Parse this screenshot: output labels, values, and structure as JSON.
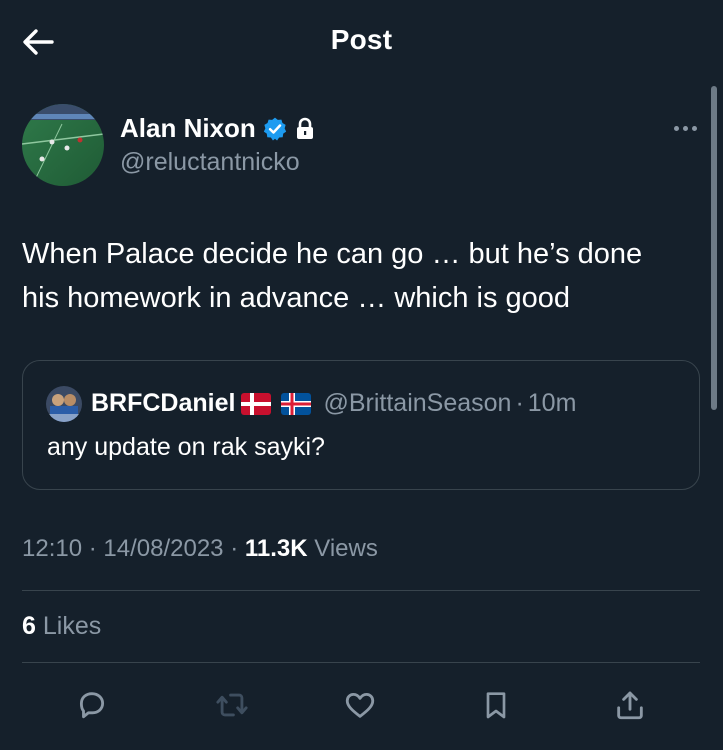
{
  "header": {
    "title": "Post"
  },
  "author": {
    "name": "Alan Nixon",
    "handle": "@reluctantnicko"
  },
  "tweet": {
    "text_line1": "When Palace decide he can go … but he’s done",
    "text_line2": "his homework in advance … which is good"
  },
  "quote": {
    "name": "BRFCDaniel",
    "handle": "@BrittainSeason",
    "separator": "·",
    "time": "10m",
    "text": "any update on rak sayki?"
  },
  "meta": {
    "time": "12:10",
    "sep1": "·",
    "date": "14/08/2023",
    "sep2": "·",
    "views_count": "11.3K",
    "views_label": "Views"
  },
  "likes": {
    "count": "6",
    "label": "Likes"
  },
  "colors": {
    "background": "#15202b",
    "secondary_text": "#8b98a5",
    "verified": "#1d9bf0",
    "divider": "#38444d"
  },
  "icons": [
    "back-arrow-icon",
    "verified-badge-icon",
    "lock-icon",
    "more-icon",
    "reply-icon",
    "retweet-icon",
    "like-icon",
    "bookmark-icon",
    "share-icon"
  ]
}
